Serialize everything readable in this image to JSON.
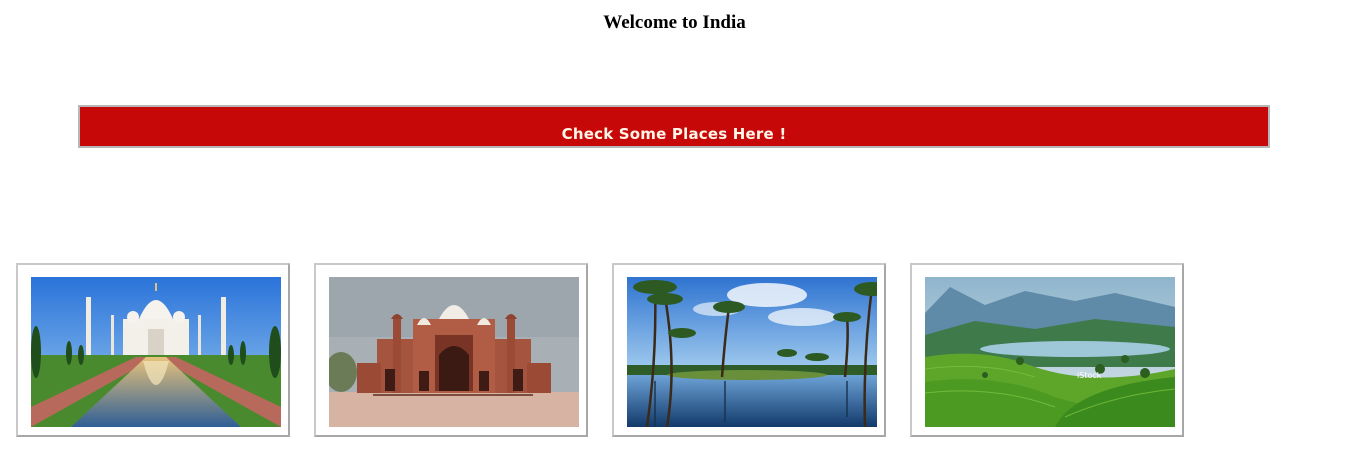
{
  "page": {
    "title": "Welcome to India"
  },
  "banner": {
    "label": "Check Some Places Here !",
    "background_color": "#c70808",
    "text_color": "#fff6e8"
  },
  "gallery": {
    "images": [
      {
        "subject": "Taj Mahal with reflecting pool"
      },
      {
        "subject": "Red sandstone mosque"
      },
      {
        "subject": "Palm trees over backwater lagoon"
      },
      {
        "subject": "Green tea plantation hills",
        "watermark": "iStock"
      }
    ]
  }
}
